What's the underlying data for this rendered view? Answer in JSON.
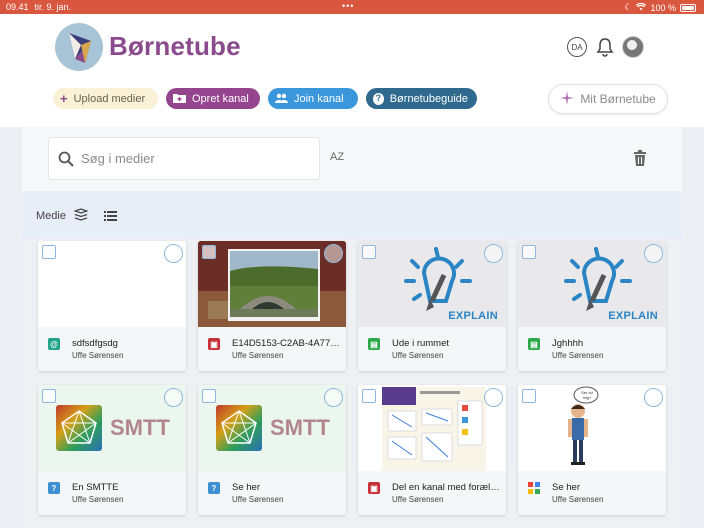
{
  "status": {
    "time": "09.41",
    "date": "tir. 9. jan.",
    "dots": "•••",
    "battery": "100 %"
  },
  "brand": {
    "name": "Børnetube"
  },
  "header": {
    "language": "DA"
  },
  "actions": {
    "upload": "Upload medier",
    "create_channel": "Opret kanal",
    "join_channel": "Join kanal",
    "guide": "Børnetubeguide",
    "my": "Mit Børnetube"
  },
  "search": {
    "placeholder": "Søg i medier",
    "sort_label": "AZ"
  },
  "filter": {
    "label": "Medie"
  },
  "colors": {
    "brand": "#8a4b8c",
    "statusbar": "#d9573f",
    "join": "#3b97dc",
    "guide": "#2f6a8e"
  },
  "items": [
    {
      "title": "sdfsdfgsdg",
      "author": "Uffe Sørensen",
      "type": "link",
      "type_color": "#1fa28a",
      "thumb": "blank"
    },
    {
      "title": "E14D5153-C2AB-4A77-…",
      "author": "Uffe Sørensen",
      "type": "image",
      "type_color": "#c62f3a",
      "thumb": "photo-bridge"
    },
    {
      "title": "Ude i rummet",
      "author": "Uffe Sørensen",
      "type": "document",
      "type_color": "#2ba84a",
      "thumb": "explain",
      "thumb_text": "EXPLAIN"
    },
    {
      "title": "Jghhhh",
      "author": "Uffe Sørensen",
      "type": "document",
      "type_color": "#2ba84a",
      "thumb": "explain",
      "thumb_text": "EXPLAIN"
    },
    {
      "title": "En SMTTE",
      "author": "Uffe Sørensen",
      "type": "question",
      "type_color": "#3d8fd4",
      "thumb": "smtt",
      "thumb_text": "SMTT"
    },
    {
      "title": "Se her",
      "author": "Uffe Sørensen",
      "type": "question",
      "type_color": "#3d8fd4",
      "thumb": "smtt",
      "thumb_text": "SMTT"
    },
    {
      "title": "Del en kanal med forældre",
      "author": "Uffe Sørensen",
      "type": "image",
      "type_color": "#c62f3a",
      "thumb": "presentation"
    },
    {
      "title": "Se her",
      "author": "Uffe Sørensen",
      "type": "pinwheel",
      "type_color": "#ffffff",
      "thumb": "character",
      "thumb_text": "Ser du mig?"
    }
  ]
}
